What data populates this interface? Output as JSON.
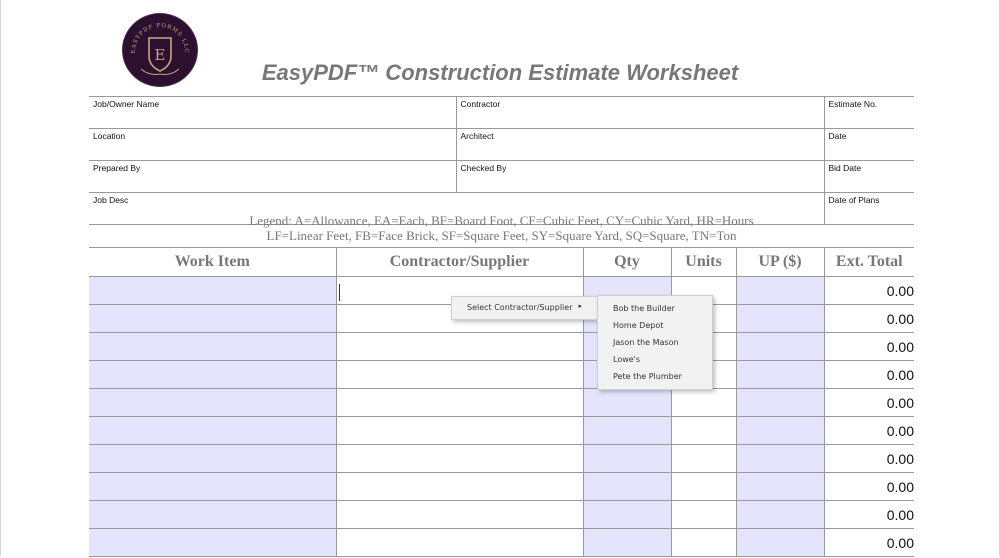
{
  "logo": {
    "text": "EASYPDF FORMS LLC",
    "initial": "E",
    "colors": {
      "bg": "#2c1030",
      "gold": "#c9a57a"
    }
  },
  "title": "EasyPDF™ Construction Estimate Worksheet",
  "info_rows": [
    {
      "left": "Job/Owner Name",
      "mid": "Contractor",
      "right": "Estimate No."
    },
    {
      "left": "Location",
      "mid": "Architect",
      "right": "Date"
    },
    {
      "left": "Prepared By",
      "mid": "Checked By",
      "right": "Bid Date"
    },
    {
      "left": "Job Desc",
      "mid": "",
      "right": "Date of Plans"
    }
  ],
  "legend": {
    "line1": "Legend: A=Allowance,  EA=Each, BF=Board Foot, CF=Cubic Feet, CY=Cubic Yard, HR=Hours",
    "line2": "LF=Linear Feet, FB=Face Brick, SF=Square Feet, SY=Square Yard, SQ=Square, TN=Ton"
  },
  "columns": [
    "Work Item",
    "Contractor/Supplier",
    "Qty",
    "Units",
    "UP ($)",
    "Ext. Total"
  ],
  "rows": [
    "0.00",
    "0.00",
    "0.00",
    "0.00",
    "0.00",
    "0.00",
    "0.00",
    "0.00",
    "0.00",
    "0.00"
  ],
  "menu": {
    "label": "Select Contractor/Supplier",
    "items": [
      "Bob the Builder",
      "Home Depot",
      "Jason the Mason",
      "Lowe's",
      "Pete the Plumber"
    ]
  },
  "colors": {
    "shade": "#e4e4fc",
    "title": "#777777"
  }
}
